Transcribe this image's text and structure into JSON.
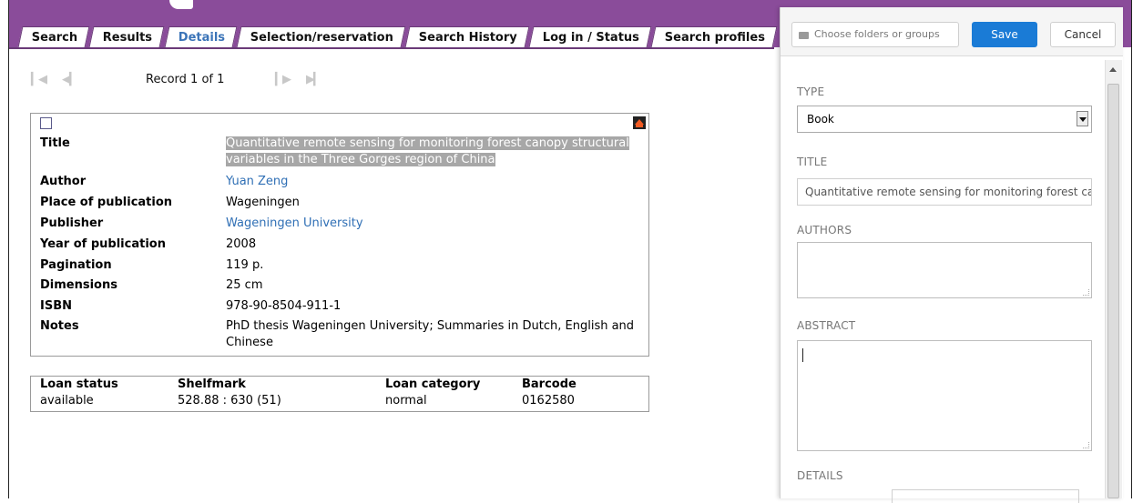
{
  "tabs": [
    {
      "label": "Search"
    },
    {
      "label": "Results"
    },
    {
      "label": "Details"
    },
    {
      "label": "Selection/reservation"
    },
    {
      "label": "Search History"
    },
    {
      "label": "Log in / Status"
    },
    {
      "label": "Search profiles"
    }
  ],
  "nav": {
    "record_label": "Record 1 of 1"
  },
  "record": {
    "fields": [
      {
        "label": "Title",
        "value": "Quantitative remote sensing for monitoring forest canopy structural variables in the Three Gorges region of China"
      },
      {
        "label": "Author",
        "value": "Yuan Zeng"
      },
      {
        "label": "Place of publication",
        "value": "Wageningen"
      },
      {
        "label": "Publisher",
        "value": "Wageningen University"
      },
      {
        "label": "Year of publication",
        "value": "2008"
      },
      {
        "label": "Pagination",
        "value": "119 p."
      },
      {
        "label": "Dimensions",
        "value": "25 cm"
      },
      {
        "label": "ISBN",
        "value": "978-90-8504-911-1"
      },
      {
        "label": "Notes",
        "value": "PhD thesis Wageningen University; Summaries in Dutch, English and Chinese"
      }
    ]
  },
  "loan": {
    "headers": [
      "Loan status",
      "Shelfmark",
      "Loan category",
      "Barcode"
    ],
    "values": [
      "available",
      "528.88 : 630 (51)",
      "normal",
      "0162580"
    ]
  },
  "panel": {
    "folders_placeholder": "Choose folders or groups",
    "save_label": "Save",
    "cancel_label": "Cancel",
    "type_heading": "TYPE",
    "type_value": "Book",
    "title_heading": "TITLE",
    "title_value": "Quantitative remote sensing for monitoring forest canopy structural variables in the Three Gorges region of China",
    "authors_heading": "AUTHORS",
    "abstract_heading": "ABSTRACT",
    "details_heading": "DETAILS"
  },
  "colors": {
    "header_purple": "#8a4c9a",
    "active_tab": "#3b74b8",
    "link": "#2f6fb5",
    "save_blue": "#1a7bd6"
  },
  "icons": [
    "first-record-icon",
    "previous-record-icon",
    "next-record-icon",
    "last-record-icon",
    "home-icon",
    "folder-icon",
    "dropdown-arrow-icon",
    "scroll-up-icon"
  ]
}
